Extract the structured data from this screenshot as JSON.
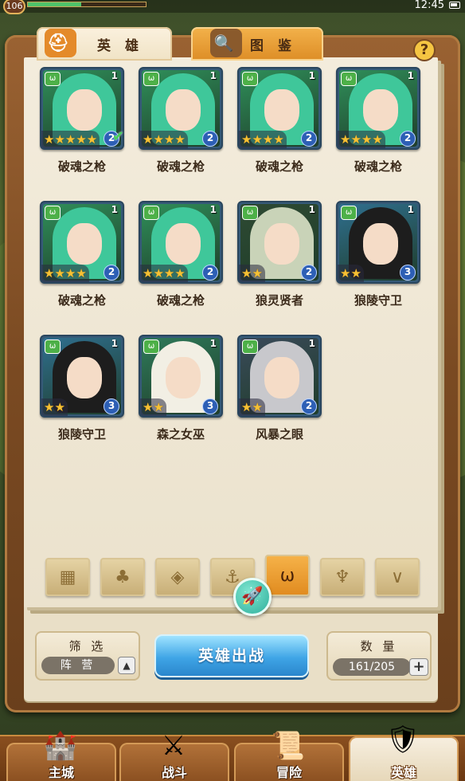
{
  "status": {
    "level": "106",
    "exp_fraction": 0.45,
    "time": "12:45"
  },
  "tabs": [
    {
      "label": "英 雄",
      "icon": "helmet-icon"
    },
    {
      "label": "图 鉴",
      "icon": "magnifier-icon"
    }
  ],
  "help_label": "?",
  "heroes": [
    {
      "name": "破魂之枪",
      "level": "1",
      "stars": 5,
      "rank": "2",
      "selected": true,
      "faction": "wolf",
      "look": "green-hair"
    },
    {
      "name": "破魂之枪",
      "level": "1",
      "stars": 4,
      "rank": "2",
      "selected": false,
      "faction": "wolf",
      "look": "green-hair"
    },
    {
      "name": "破魂之枪",
      "level": "1",
      "stars": 4,
      "rank": "2",
      "selected": false,
      "faction": "wolf",
      "look": "green-hair"
    },
    {
      "name": "破魂之枪",
      "level": "1",
      "stars": 4,
      "rank": "2",
      "selected": false,
      "faction": "wolf",
      "look": "green-hair"
    },
    {
      "name": "破魂之枪",
      "level": "1",
      "stars": 4,
      "rank": "2",
      "selected": false,
      "faction": "wolf",
      "look": "green-hair"
    },
    {
      "name": "破魂之枪",
      "level": "1",
      "stars": 4,
      "rank": "2",
      "selected": false,
      "faction": "wolf",
      "look": "green-hair"
    },
    {
      "name": "狼灵贤者",
      "level": "1",
      "stars": 2,
      "rank": "2",
      "selected": false,
      "faction": "wolf",
      "look": "owl"
    },
    {
      "name": "狼陵守卫",
      "level": "1",
      "stars": 2,
      "rank": "3",
      "selected": false,
      "faction": "wolf",
      "look": "wolf-beast"
    },
    {
      "name": "狼陵守卫",
      "level": "1",
      "stars": 2,
      "rank": "3",
      "selected": false,
      "faction": "wolf",
      "look": "wolf-beast"
    },
    {
      "name": "森之女巫",
      "level": "1",
      "stars": 2,
      "rank": "3",
      "selected": false,
      "faction": "wolf",
      "look": "elf"
    },
    {
      "name": "风暴之眼",
      "level": "1",
      "stars": 2,
      "rank": "2",
      "selected": false,
      "faction": "wolf",
      "look": "silver-hair"
    }
  ],
  "faction_filters": [
    {
      "icon": "grid-all-icon",
      "active": false
    },
    {
      "icon": "leaf-faction-icon",
      "active": false
    },
    {
      "icon": "diamond-faction-icon",
      "active": false
    },
    {
      "icon": "anchor-faction-icon",
      "active": false
    },
    {
      "icon": "wolf-faction-icon",
      "active": true
    },
    {
      "icon": "horns-faction-icon",
      "active": false
    },
    {
      "icon": "wings-faction-icon",
      "active": false
    }
  ],
  "filter": {
    "title": "筛 选",
    "value": "阵 营"
  },
  "deploy_label": "英雄出战",
  "count": {
    "title": "数 量",
    "value": "161/205"
  },
  "nav": [
    {
      "label": "主城",
      "icon": "castle-icon",
      "active": false
    },
    {
      "label": "战斗",
      "icon": "crossed-swords-icon",
      "active": false
    },
    {
      "label": "冒险",
      "icon": "map-scroll-icon",
      "active": false
    },
    {
      "label": "英雄",
      "icon": "hero-crest-icon",
      "active": true
    }
  ]
}
